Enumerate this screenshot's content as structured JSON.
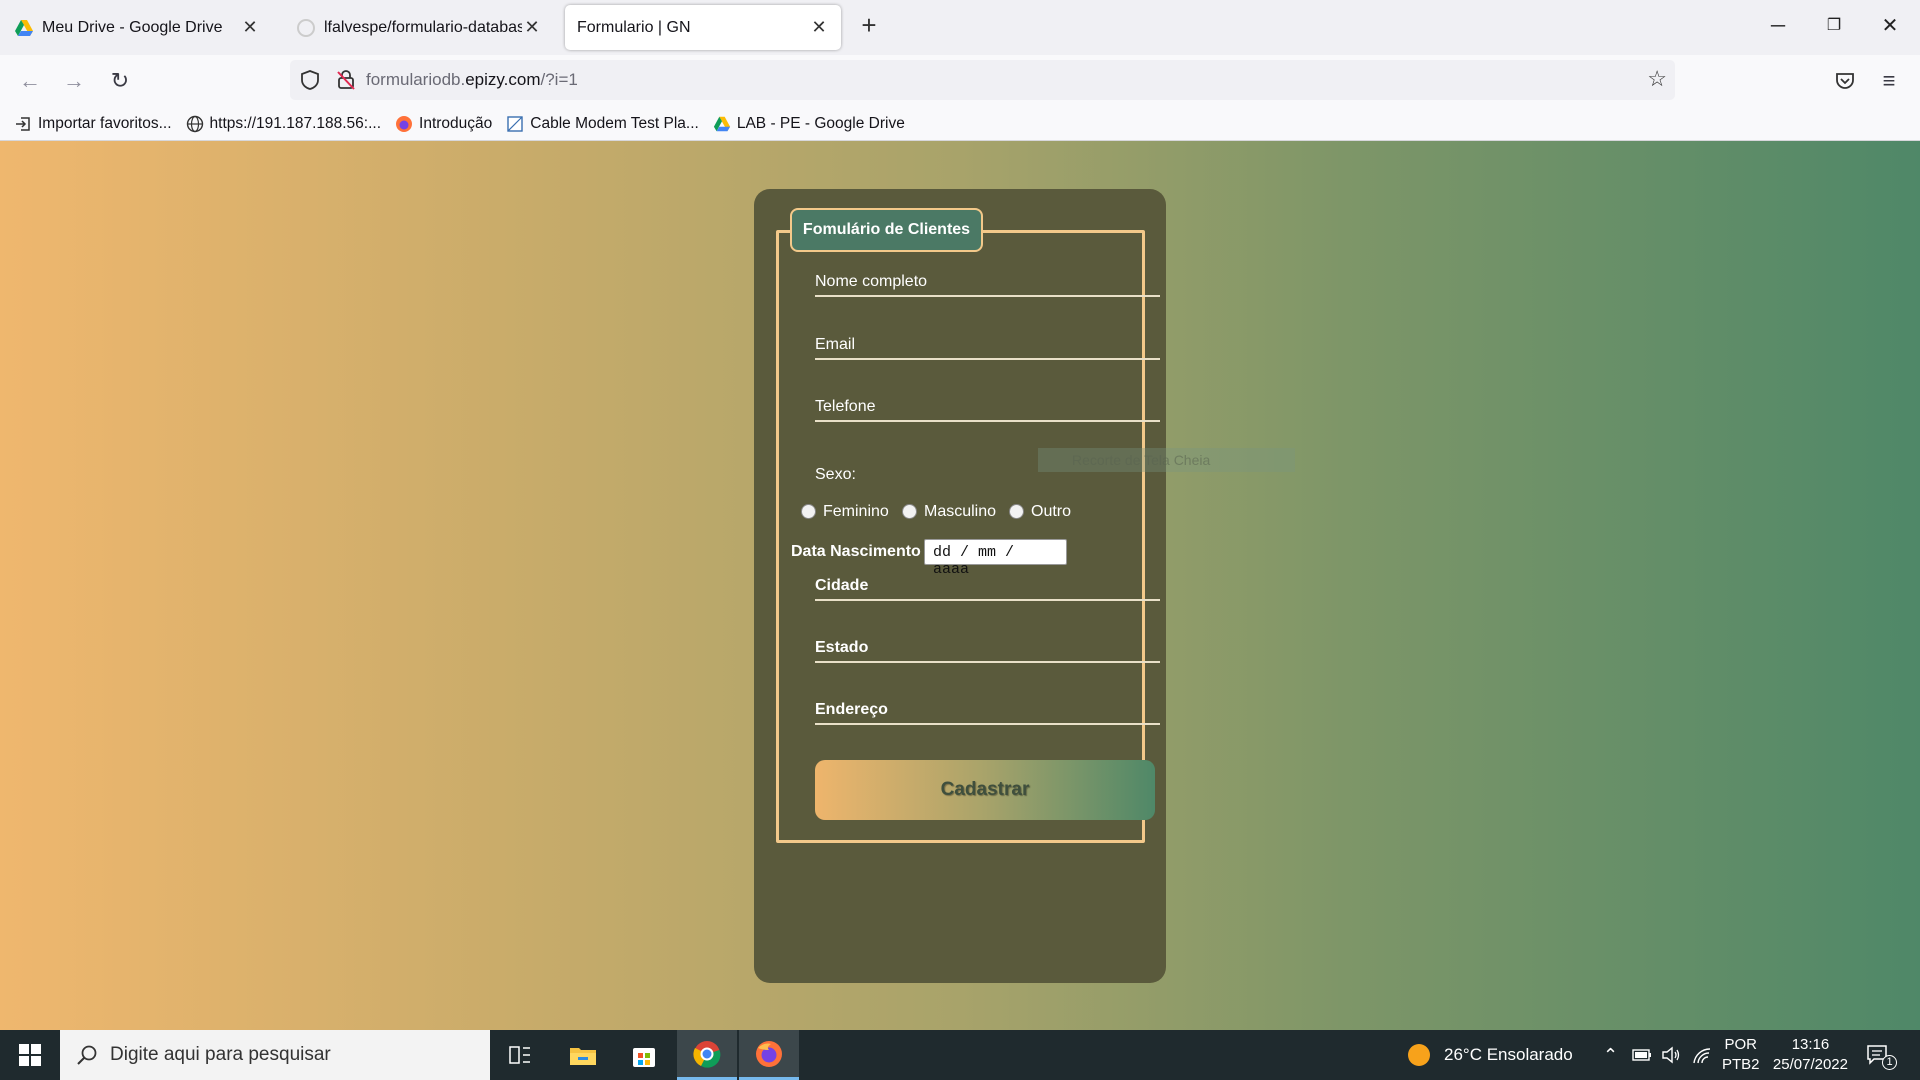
{
  "browser": {
    "tabs": [
      {
        "label": "Meu Drive - Google Drive",
        "icon": "google-drive-icon",
        "active": false
      },
      {
        "label": "lfalvespe/formulario-database",
        "icon": "github-icon",
        "active": false
      },
      {
        "label": "Formulario | GN",
        "icon": "none",
        "active": true
      }
    ],
    "new_tab": "+",
    "url_prefix": "formulariodb.",
    "url_domain": "epizy.com",
    "url_path": "/?i=1",
    "bookmarks": [
      {
        "label": "Importar favoritos...",
        "icon": "import-icon"
      },
      {
        "label": "https://191.187.188.56:...",
        "icon": "globe-icon"
      },
      {
        "label": "Introdução",
        "icon": "firefox-icon"
      },
      {
        "label": "Cable Modem Test Pla...",
        "icon": "document-icon"
      },
      {
        "label": "LAB - PE - Google Drive",
        "icon": "google-drive-icon"
      }
    ]
  },
  "form": {
    "legend": "Fomulário de Clientes",
    "fields": {
      "nome": "Nome completo",
      "email": "Email",
      "telefone": "Telefone",
      "cidade": "Cidade",
      "estado": "Estado",
      "endereco": "Endereço"
    },
    "sexo_label": "Sexo:",
    "sexo_options": [
      "Feminino",
      "Masculino",
      "Outro"
    ],
    "data_label": "Data Nascimento",
    "date_placeholder": "dd / mm / aaaa",
    "submit": "Cadastrar"
  },
  "overlay": {
    "snip_text": "Recorte de Tela Cheia"
  },
  "taskbar": {
    "search_placeholder": "Digite aqui para pesquisar",
    "weather": "26°C  Ensolarado",
    "lang_top": "POR",
    "lang_bottom": "PTB2",
    "time": "13:16",
    "date": "25/07/2022",
    "notification_count": "1"
  }
}
